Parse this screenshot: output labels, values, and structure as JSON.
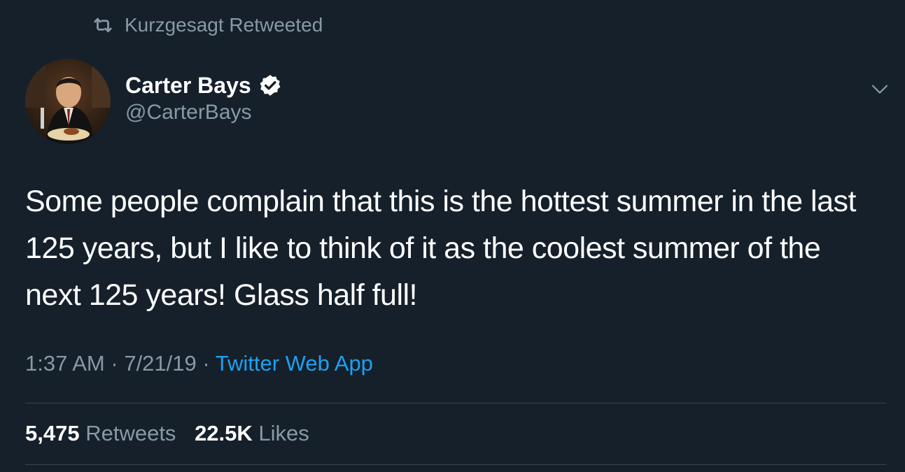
{
  "retweet_banner": {
    "text": "Kurzgesagt Retweeted",
    "icon": "retweet-icon"
  },
  "author": {
    "display_name": "Carter Bays",
    "handle": "@CarterBays",
    "verified": true,
    "avatar_alt": "avatar"
  },
  "tweet": {
    "text": "Some people complain that this is the hottest summer in the last 125 years, but I like to think of it as the coolest summer of the next 125 years! Glass half full!",
    "time": "1:37 AM",
    "separator": "·",
    "date": "7/21/19",
    "source": "Twitter Web App"
  },
  "stats": {
    "retweets_count": "5,475",
    "retweets_label": "Retweets",
    "likes_count": "22.5K",
    "likes_label": "Likes"
  },
  "colors": {
    "background": "#15202b",
    "secondary_text": "#8899a6",
    "link": "#1da1f2",
    "divider": "#38444d"
  }
}
